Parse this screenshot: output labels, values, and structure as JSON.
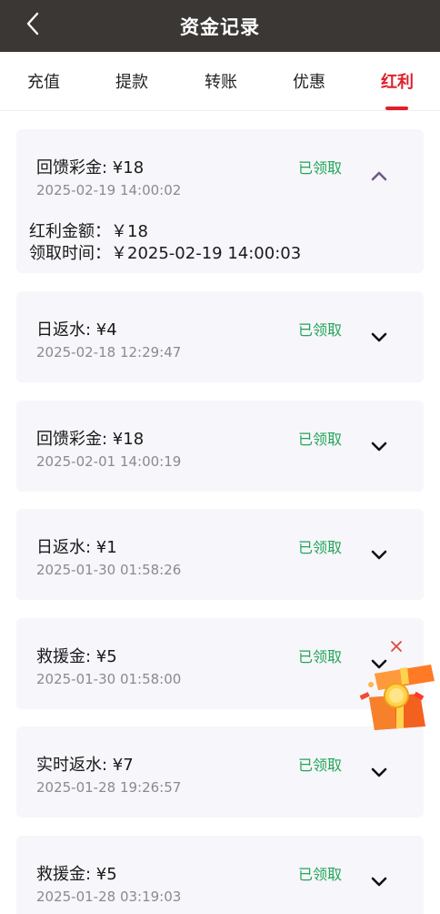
{
  "header": {
    "title": "资金记录"
  },
  "tabs": [
    {
      "label": "充值",
      "active": false
    },
    {
      "label": "提款",
      "active": false
    },
    {
      "label": "转账",
      "active": false
    },
    {
      "label": "优惠",
      "active": false
    },
    {
      "label": "红利",
      "active": true
    }
  ],
  "records": [
    {
      "title": "回馈彩金: ¥18",
      "time": "2025-02-19 14:00:02",
      "status": "已领取",
      "expanded": true,
      "details": {
        "amount": "红利金额：￥18",
        "claim_time": "领取时间：￥2025-02-19 14:00:03"
      }
    },
    {
      "title": "日返水: ¥4",
      "time": "2025-02-18 12:29:47",
      "status": "已领取",
      "expanded": false
    },
    {
      "title": "回馈彩金: ¥18",
      "time": "2025-02-01 14:00:19",
      "status": "已领取",
      "expanded": false
    },
    {
      "title": "日返水: ¥1",
      "time": "2025-01-30 01:58:26",
      "status": "已领取",
      "expanded": false
    },
    {
      "title": "救援金: ¥5",
      "time": "2025-01-30 01:58:00",
      "status": "已领取",
      "expanded": false
    },
    {
      "title": "实时返水: ¥7",
      "time": "2025-01-28 19:26:57",
      "status": "已领取",
      "expanded": false
    },
    {
      "title": "救援金: ¥5",
      "time": "2025-01-28 03:19:03",
      "status": "已领取",
      "expanded": false
    }
  ],
  "colors": {
    "header_bg": "#3b3735",
    "accent_red": "#e0202a",
    "status_green": "#23a558",
    "card_bg": "#f6f6fb",
    "expanded_chevron": "#6f5a86"
  },
  "icons": {
    "back": "chevron-left-icon",
    "collapse": "chevron-up-icon",
    "expand": "chevron-down-icon",
    "promo_close": "close-icon",
    "promo": "gift-box-icon"
  }
}
